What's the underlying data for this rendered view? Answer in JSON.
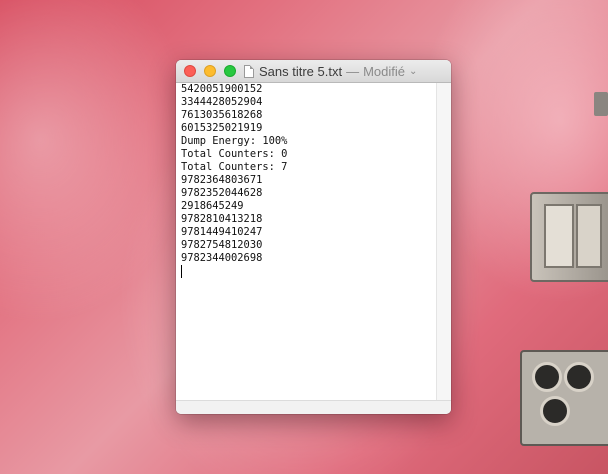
{
  "window": {
    "title": "Sans titre 5.txt",
    "separator": "—",
    "status": "Modifié",
    "doc_icon": "document-icon",
    "chevron_icon": "chevron-down-icon"
  },
  "traffic_lights": {
    "close_color": "#fc5f57",
    "minimize_color": "#fdbc2e",
    "zoom_color": "#28c840"
  },
  "editor": {
    "lines": [
      "5420051900152",
      "3344428052904",
      "7613035618268",
      "6015325021919",
      "Dump Energy: 100%",
      "Total Counters: 0",
      "Total Counters: 7",
      "9782364803671",
      "9782352044628",
      "2918645249",
      "9782810413218",
      "9781449410247",
      "9782754812030",
      "9782344002698"
    ]
  }
}
